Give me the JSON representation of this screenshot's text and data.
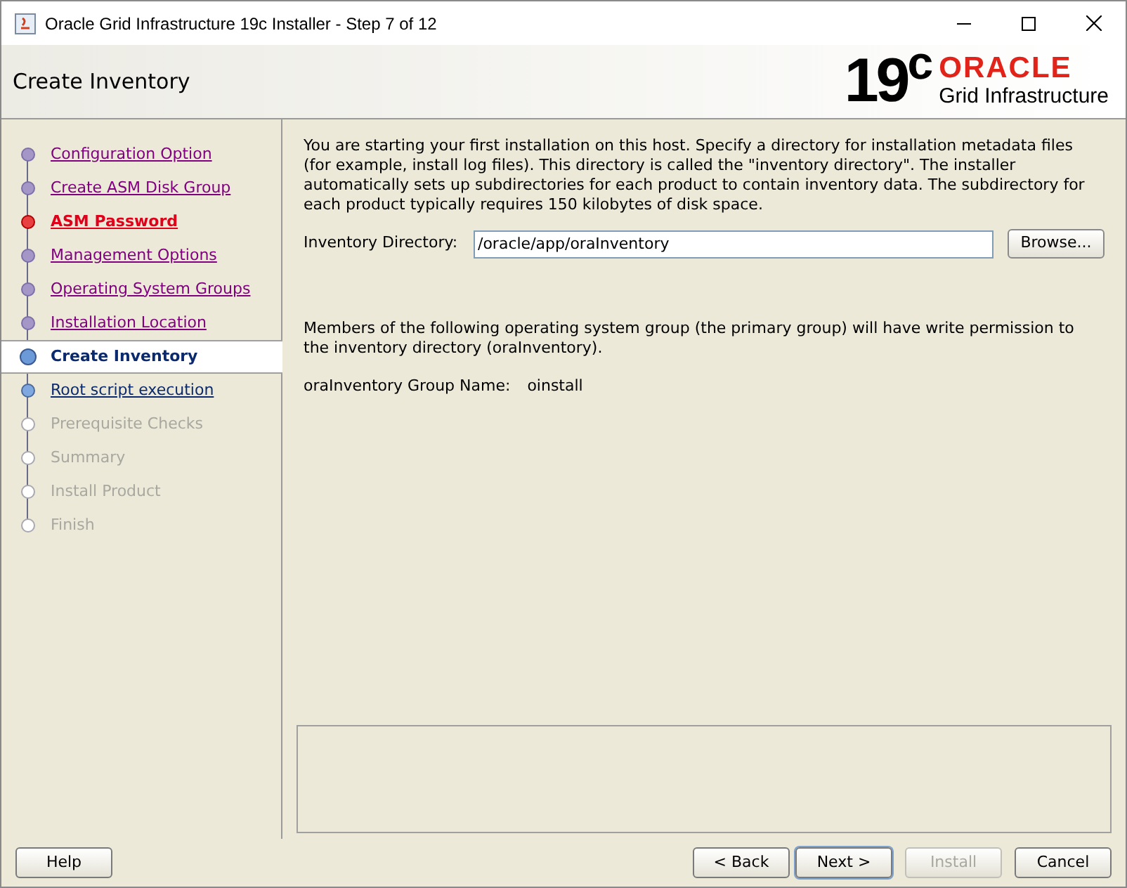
{
  "window": {
    "title": "Oracle Grid Infrastructure 19c Installer - Step 7 of 12"
  },
  "header": {
    "title": "Create Inventory",
    "logo": {
      "version": "19$^{c}$",
      "brand": "ORACLE",
      "product": "Grid Infrastructure"
    }
  },
  "steps": [
    {
      "label": "Configuration Option",
      "kind": "done"
    },
    {
      "label": "Create ASM Disk Group",
      "kind": "done"
    },
    {
      "label": "ASM Password",
      "kind": "error"
    },
    {
      "label": "Management Options",
      "kind": "done"
    },
    {
      "label": "Operating System Groups",
      "kind": "done"
    },
    {
      "label": "Installation Location",
      "kind": "done"
    },
    {
      "label": "Create Inventory",
      "kind": "current"
    },
    {
      "label": "Root script execution",
      "kind": "next"
    },
    {
      "label": "Prerequisite Checks",
      "kind": "pending"
    },
    {
      "label": "Summary",
      "kind": "pending"
    },
    {
      "label": "Install Product",
      "kind": "pending"
    },
    {
      "label": "Finish",
      "kind": "pending"
    }
  ],
  "content": {
    "intro": "You are starting your first installation on this host. Specify a directory for installation metadata files (for example, install log files). This directory is called the \"inventory directory\". The installer automatically sets up subdirectories for each product to contain inventory data. The subdirectory for each product typically requires 150 kilobytes of disk space.",
    "directory_label": "Inventory Directory:",
    "directory_value": "/oracle/app/oraInventory",
    "browse_button": "Browse...",
    "group_note": "Members of the following operating system group (the primary group) will have write permission to the inventory directory (oraInventory).",
    "group_label": "oraInventory Group Name:",
    "group_value": "oinstall"
  },
  "buttons": [
    {
      "label": "Help",
      "disabled": false,
      "focused": false
    },
    {
      "label": "< Back",
      "disabled": false,
      "focused": false
    },
    {
      "label": "Next >",
      "disabled": false,
      "focused": true
    },
    {
      "label": "Install",
      "disabled": true,
      "focused": false
    },
    {
      "label": "Cancel",
      "disabled": false,
      "focused": false
    }
  ]
}
